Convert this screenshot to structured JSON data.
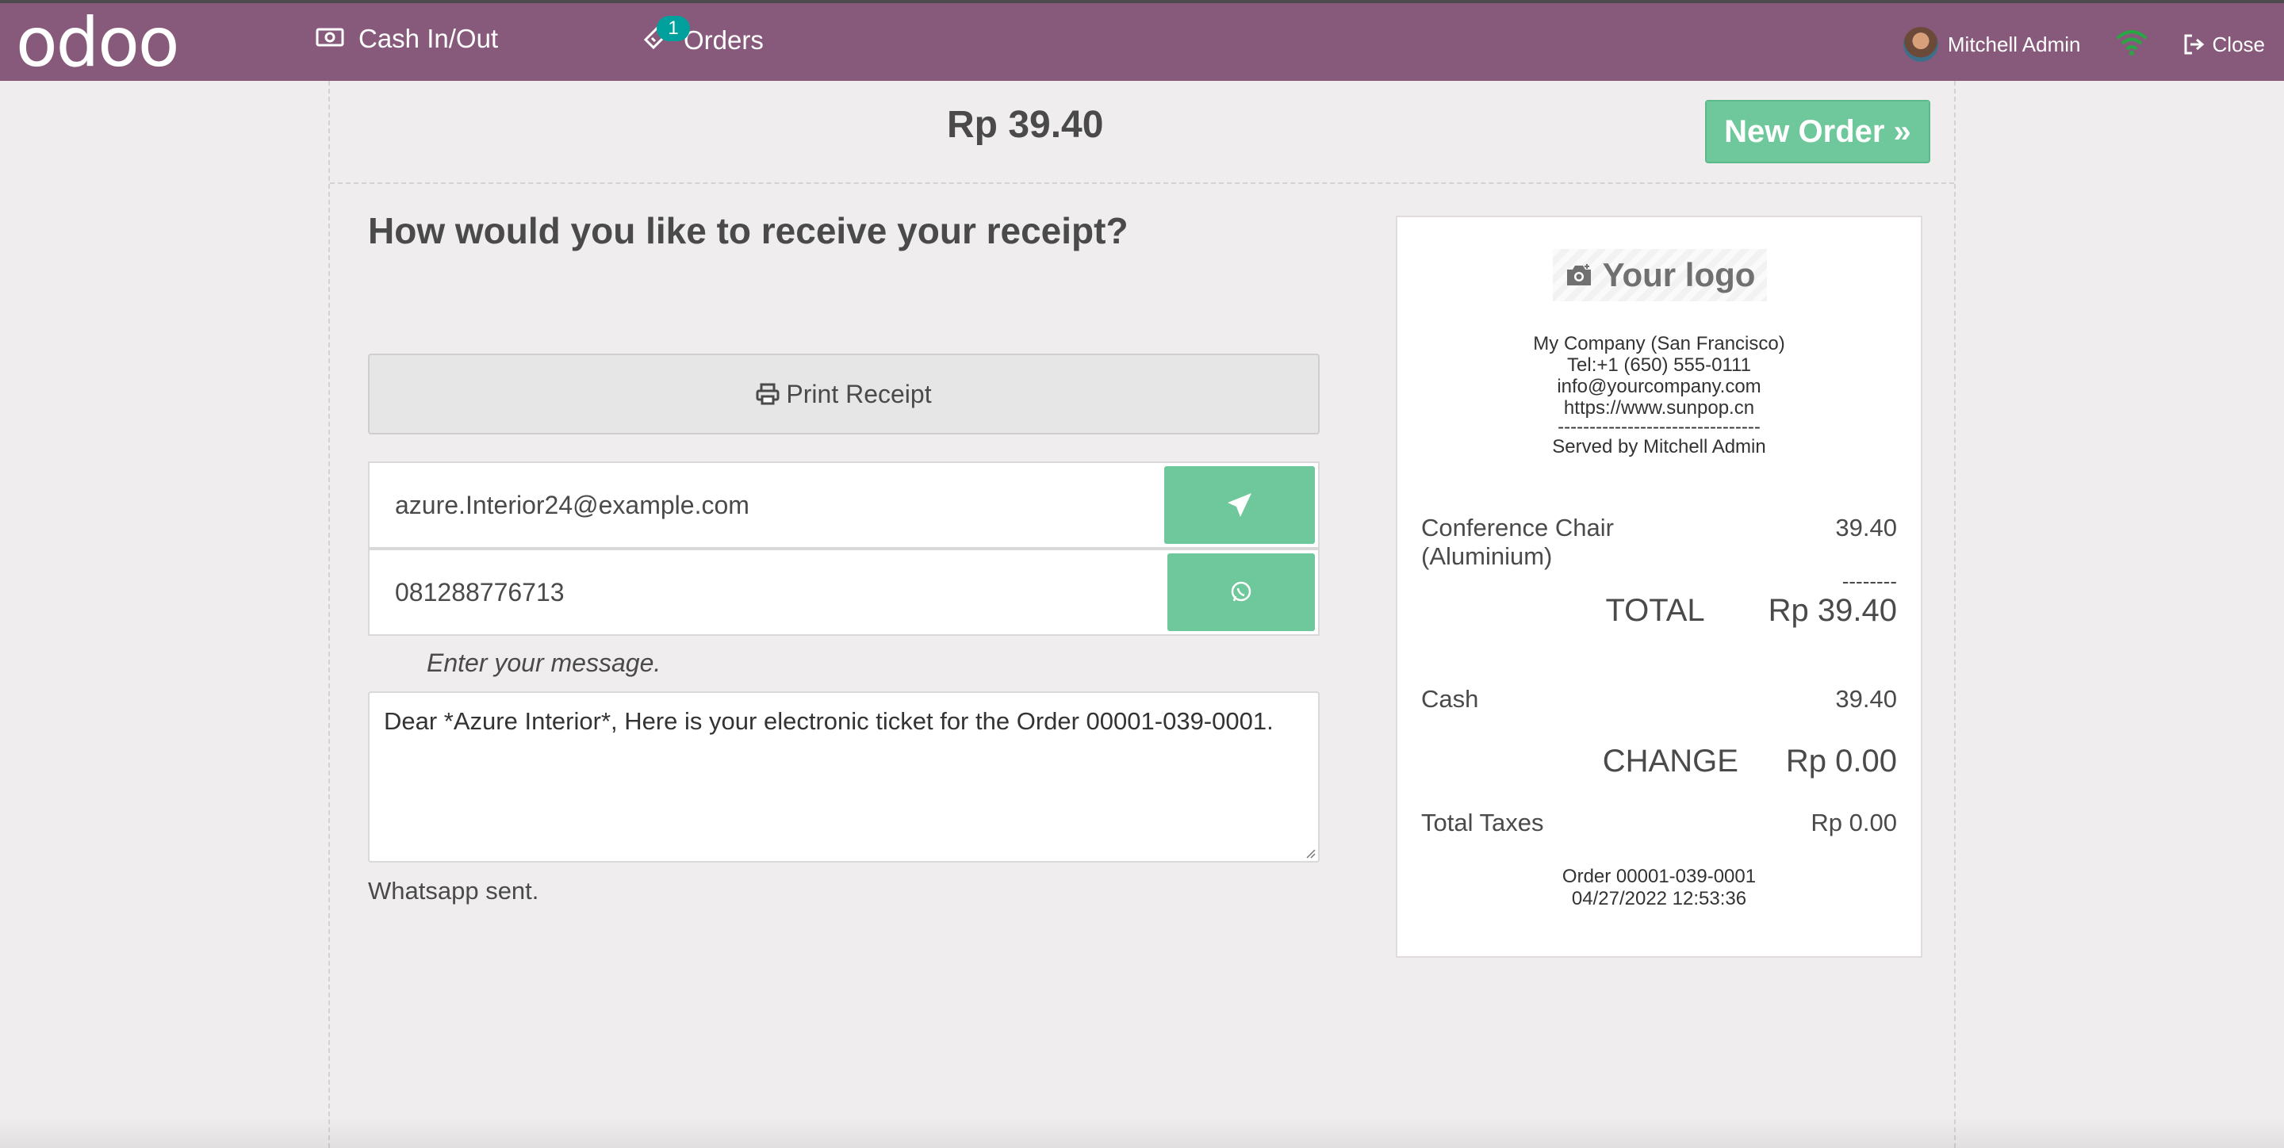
{
  "navbar": {
    "logo_text": "odoo",
    "cash_label": "Cash In/Out",
    "orders_label": "Orders",
    "orders_badge": "1",
    "user_name": "Mitchell Admin",
    "close_label": "Close",
    "bg_color": "#875a7b"
  },
  "main": {
    "total_amount": "Rp 39.40",
    "new_order_label": "New Order »",
    "question": "How would you like to receive your receipt?",
    "print_label": "Print Receipt",
    "email_value": "azure.Interior24@example.com",
    "phone_value": "081288776713",
    "message_label": "Enter your message.",
    "message_text": "Dear *Azure Interior*, Here is your electronic ticket for the Order 00001-039-0001.",
    "status_text": "Whatsapp sent.",
    "accent_color": "#6ec89b"
  },
  "receipt": {
    "logo_text": "Your logo",
    "company_name": "My Company (San Francisco)",
    "phone": "Tel:+1 (650) 555-0111",
    "email": "info@yourcompany.com",
    "website": "https://www.sunpop.cn",
    "separator": "--------------------------------",
    "served_by": "Served by Mitchell Admin",
    "items": [
      {
        "name_line1": "Conference Chair",
        "name_line2": "(Aluminium)",
        "price": "39.40"
      }
    ],
    "dashes": "--------",
    "total_label": "TOTAL",
    "total_value": "Rp 39.40",
    "payment_method": "Cash",
    "payment_amount": "39.40",
    "change_label": "CHANGE",
    "change_value": "Rp 0.00",
    "taxes_label": "Total Taxes",
    "taxes_value": "Rp 0.00",
    "order_ref": "Order 00001-039-0001",
    "order_date": "04/27/2022 12:53:36"
  }
}
